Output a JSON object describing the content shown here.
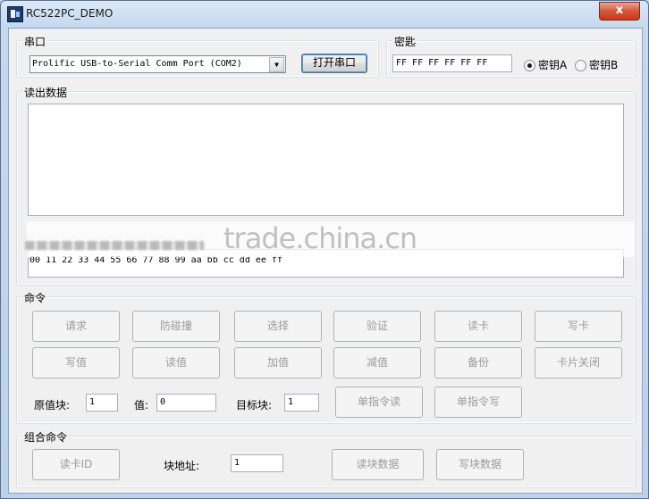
{
  "window": {
    "title": "RC522PC_DEMO",
    "close": "x"
  },
  "serial": {
    "legend": "串口",
    "port": "Prolific USB-to-Serial Comm Port (COM2)",
    "open_button": "打开串口"
  },
  "key": {
    "legend": "密匙",
    "value": "FF FF FF FF FF FF",
    "options": [
      {
        "label": "密钥A",
        "selected": true
      },
      {
        "label": "密钥B",
        "selected": false
      }
    ]
  },
  "readout": {
    "legend": "读出数据",
    "hex_line": "00 11 22 33 44 55 66 77 88 99 aa bb cc dd ee ff",
    "watermark": "trade.china.cn"
  },
  "commands": {
    "legend": "命令",
    "row1": [
      "请求",
      "防碰撞",
      "选择",
      "验证",
      "读卡",
      "写卡"
    ],
    "row2": [
      "写值",
      "读值",
      "加值",
      "减值",
      "备份",
      "卡片关闭"
    ],
    "original_block_label": "原值块:",
    "original_block_value": "1",
    "value_label": "值:",
    "value_value": "0",
    "target_block_label": "目标块:",
    "target_block_value": "1",
    "single_read": "单指令读",
    "single_write": "单指令写"
  },
  "combo_commands": {
    "legend": "组合命令",
    "read_id": "读卡ID",
    "block_addr_label": "块地址:",
    "block_addr_value": "1",
    "read_block": "读块数据",
    "write_block": "写块数据"
  }
}
